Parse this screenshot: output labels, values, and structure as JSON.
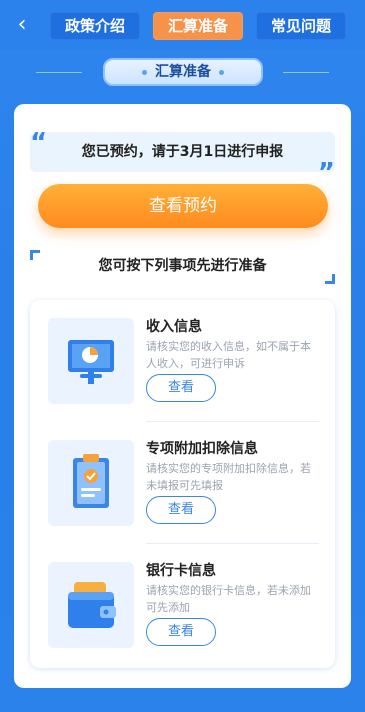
{
  "header": {
    "back_icon": "chevron-left-icon",
    "tabs": [
      {
        "label": "政策介绍",
        "active": false
      },
      {
        "label": "汇算准备",
        "active": true
      },
      {
        "label": "常见问题",
        "active": false
      }
    ],
    "active_color": "#f6924a",
    "inactive_color": "#1f6fe0"
  },
  "section": {
    "title": "汇算准备"
  },
  "notice": {
    "text": "您已预约，请于3月1日进行申报"
  },
  "main_button": {
    "label": "查看预约"
  },
  "prep": {
    "title": "您可按下列事项先进行准备"
  },
  "items": [
    {
      "title": "收入信息",
      "desc": "请核实您的收入信息，如不属于本人收入，可进行申诉",
      "button": "查看",
      "icon": "presentation-chart-icon"
    },
    {
      "title": "专项附加扣除信息",
      "desc": "请核实您的专项附加扣除信息，若未填报可先填报",
      "button": "查看",
      "icon": "clipboard-check-icon"
    },
    {
      "title": "银行卡信息",
      "desc": "请核实您的银行卡信息，若未添加可先添加",
      "button": "查看",
      "icon": "wallet-icon"
    }
  ]
}
